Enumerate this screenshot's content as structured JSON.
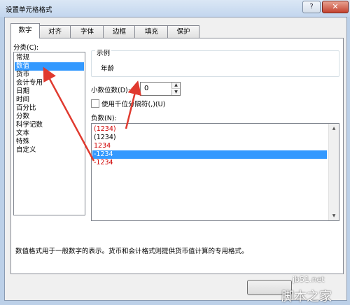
{
  "window": {
    "title": "设置单元格格式",
    "help_glyph": "?",
    "close_glyph": "✕"
  },
  "tabs": [
    {
      "label": "数字"
    },
    {
      "label": "对齐"
    },
    {
      "label": "字体"
    },
    {
      "label": "边框"
    },
    {
      "label": "填充"
    },
    {
      "label": "保护"
    }
  ],
  "category": {
    "label": "分类(C):",
    "items": [
      "常规",
      "数值",
      "货币",
      "会计专用",
      "日期",
      "时间",
      "百分比",
      "分数",
      "科学记数",
      "文本",
      "特殊",
      "自定义"
    ],
    "selected": "数值"
  },
  "example": {
    "caption": "示例",
    "value": "年龄"
  },
  "decimal": {
    "label": "小数位数(D):",
    "value": "0"
  },
  "thousands": {
    "label": "使用千位分隔符(,)(U)",
    "checked": false
  },
  "negative": {
    "label": "负数(N):",
    "items": [
      "(1234)",
      "(1234)",
      "1234",
      "-1234",
      "-1234"
    ],
    "selected": "-1234"
  },
  "description": "数值格式用于一般数字的表示。货币和会计格式则提供货币值计算的专用格式。",
  "watermark": {
    "site": "jb51.net",
    "name": "脚本之家"
  },
  "colors": {
    "selection": "#3399ff",
    "negative_red": "#d00000",
    "annotation": "#e03a2f"
  }
}
